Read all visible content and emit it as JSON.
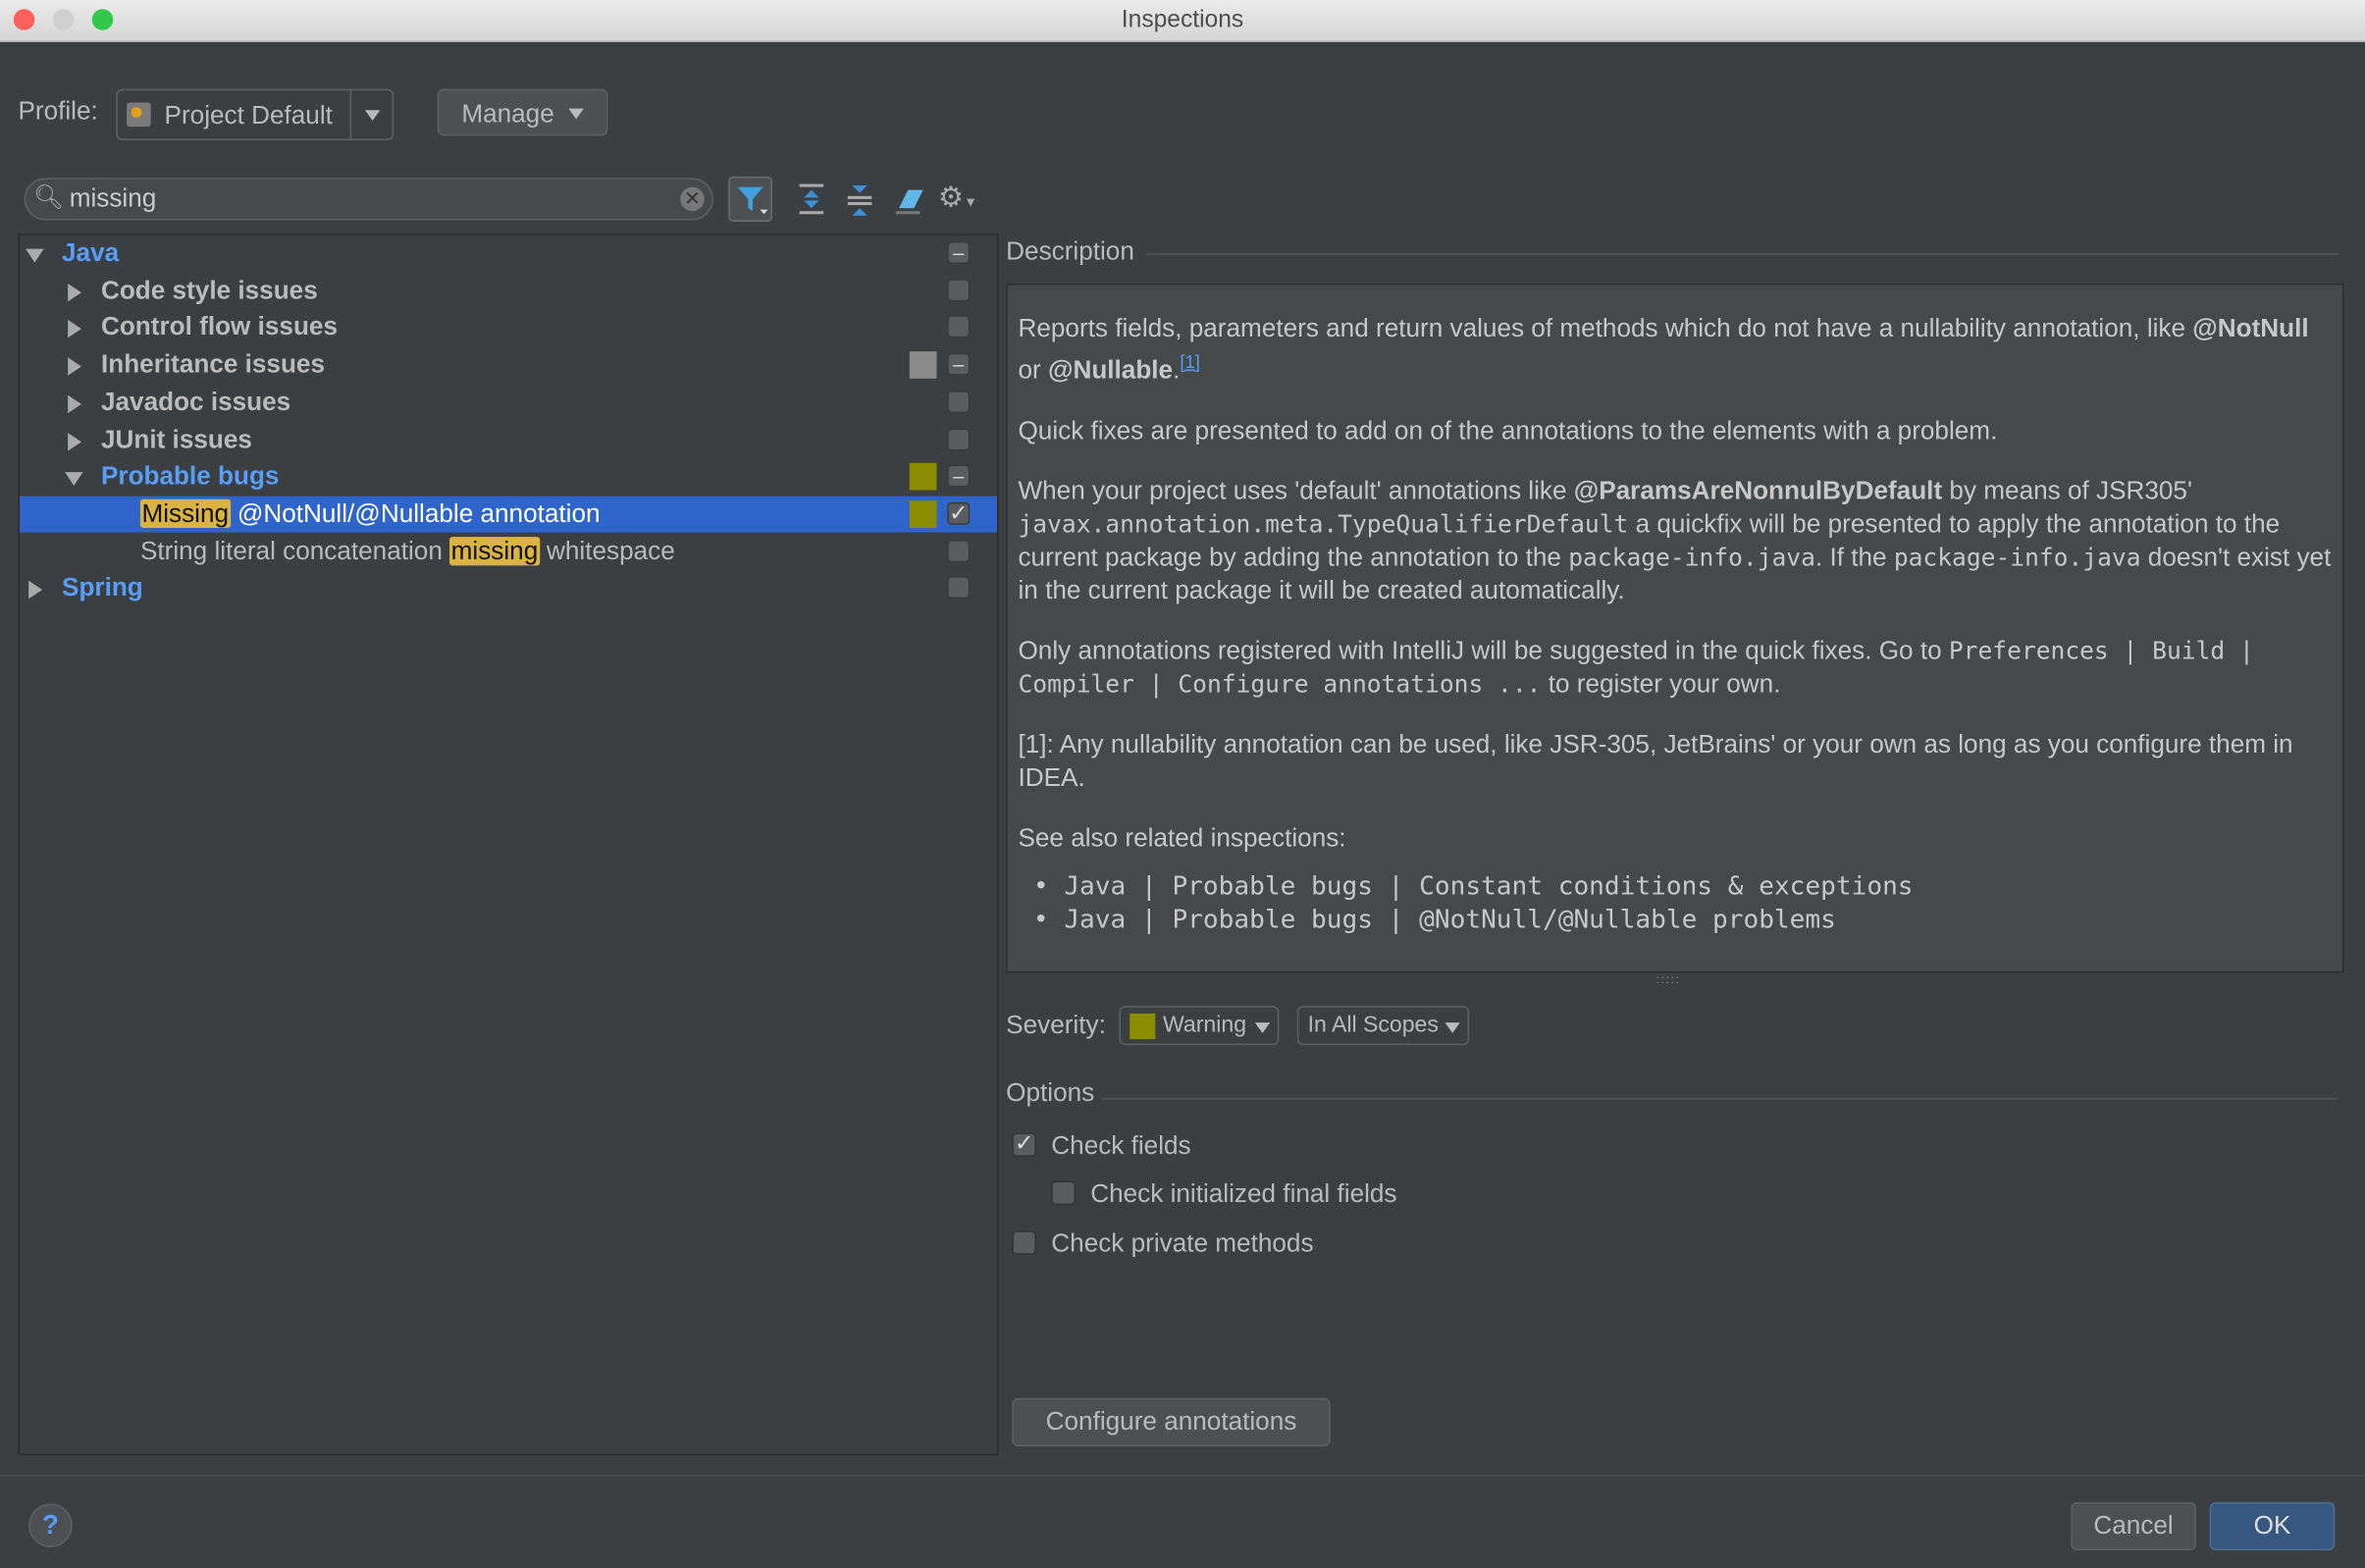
{
  "window": {
    "title": "Inspections"
  },
  "profile": {
    "label": "Profile:",
    "value": "Project Default",
    "manage": "Manage"
  },
  "search": {
    "value": "missing",
    "placeholder": ""
  },
  "tree": {
    "java": "Java",
    "groups": [
      "Code style issues",
      "Control flow issues",
      "Inheritance issues",
      "Javadoc issues",
      "JUnit issues"
    ],
    "probable": "Probable bugs",
    "item1_hl": "Missing",
    "item1_rest": " @NotNull/@Nullable annotation",
    "item2_pre": "String literal concatenation ",
    "item2_hl": "missing",
    "item2_post": " whitespace",
    "spring": "Spring"
  },
  "colors": {
    "warning": "#8c8c00",
    "selection": "#2f65ca",
    "weak": "#8a8a8a",
    "highlight": "#d9b442"
  },
  "description": {
    "label": "Description",
    "p1a": "Reports fields, parameters and return values of methods which do not have a nullability annotation, like ",
    "p1b": "@NotNull",
    "p1c": " or ",
    "p1d": "@Nullable",
    "p1e": ".",
    "p1ref": "[1]",
    "p2": "Quick fixes are presented to add on of the annotations to the elements with a problem.",
    "p3a": "When your project uses 'default' annotations like ",
    "p3b": "@ParamsAreNonnulByDefault",
    "p3c": " by means of JSR305' ",
    "p3d": "javax.annotation.meta.TypeQualifierDefault",
    "p3e": " a quickfix will be presented to apply the annotation to the current package by adding the annotation to the ",
    "p3f": "package-info.java",
    "p3g": ". If the ",
    "p3h": "package-info.java",
    "p3i": " doesn't exist yet in the current package it will be created automatically.",
    "p4a": "Only annotations registered with IntelliJ will be suggested in the quick fixes. Go to ",
    "p4b": "Preferences | Build | Compiler | Configure annotations ...",
    "p4c": " to register your own.",
    "p5": "[1]: Any nullability annotation can be used, like JSR-305, JetBrains' or your own as long as you configure them in IDEA.",
    "p6": "See also related inspections:",
    "related": [
      "Java | Probable bugs | Constant conditions & exceptions",
      "Java | Probable bugs | @NotNull/@Nullable problems"
    ]
  },
  "severity": {
    "label": "Severity:",
    "value": "Warning",
    "scope": "In All Scopes"
  },
  "options": {
    "label": "Options",
    "items": [
      {
        "label": "Check fields",
        "checked": true
      },
      {
        "label": "Check initialized final fields",
        "checked": false
      },
      {
        "label": "Check private methods",
        "checked": false
      }
    ],
    "configure": "Configure annotations"
  },
  "footer": {
    "help": "?",
    "cancel": "Cancel",
    "ok": "OK"
  }
}
